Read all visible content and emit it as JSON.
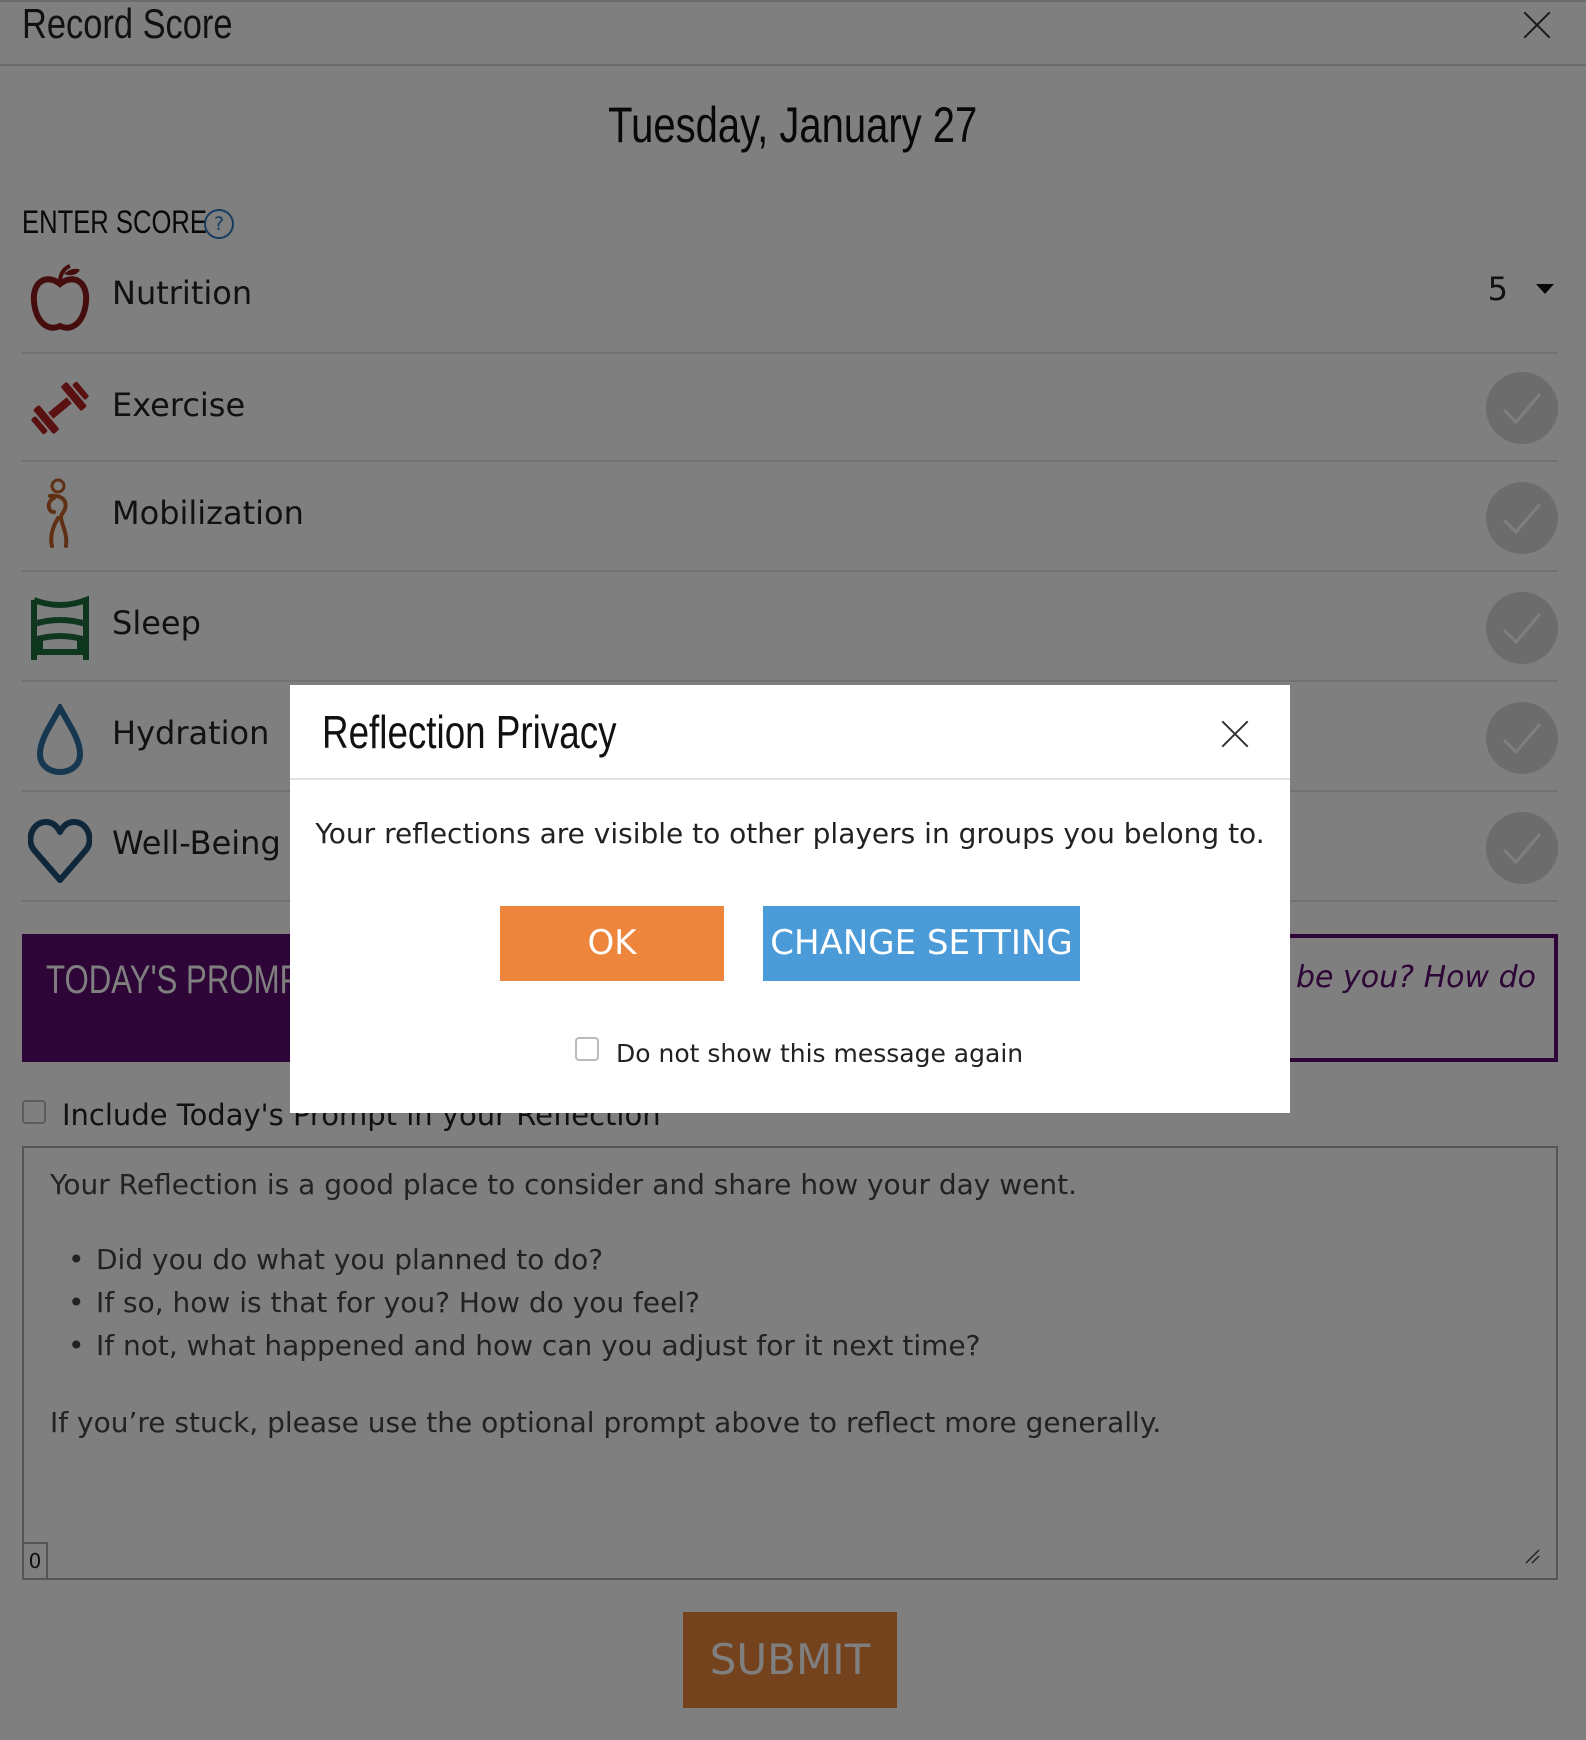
{
  "header": {
    "title": "Record Score"
  },
  "date": "Tuesday, January 27",
  "enter_score": {
    "label": "ENTER SCORE",
    "help_glyph": "?"
  },
  "categories": [
    {
      "label": "Nutrition",
      "icon": "apple-icon",
      "color": "#8a1a1a",
      "score": "5"
    },
    {
      "label": "Exercise",
      "icon": "dumbbell-icon",
      "color": "#b52323"
    },
    {
      "label": "Mobilization",
      "icon": "stretching-figure-icon",
      "color": "#c0612a"
    },
    {
      "label": "Sleep",
      "icon": "bed-icon",
      "color": "#1e6e3a"
    },
    {
      "label": "Hydration",
      "icon": "water-drop-icon",
      "color": "#2a6fa0"
    },
    {
      "label": "Well-Being",
      "icon": "heart-icon",
      "color": "#1c4e77"
    }
  ],
  "prompt": {
    "label": "TODAY'S PROMPT",
    "visible_text": "be you? How do",
    "color": "#5a0a6e"
  },
  "include_prompt": {
    "label": "Include Today's Prompt in your Reflection",
    "checked": false
  },
  "reflection": {
    "intro": "Your Reflection is a good place to consider and share how your day went.",
    "bullets": [
      "Did you do what you planned to do?",
      "If so, how is that for you? How do you feel?",
      "If not, what happened and how can you adjust for it next time?"
    ],
    "outro": "If you’re stuck, please use the optional prompt above to reflect more generally.",
    "char_count": "0"
  },
  "submit_label": "SUBMIT",
  "modal": {
    "title": "Reflection Privacy",
    "message": "Your reflections are visible to other players in groups you belong to.",
    "ok_label": "OK",
    "change_label": "CHANGE SETTING",
    "dont_show_label": "Do not show this message again",
    "dont_show_checked": false
  },
  "colors": {
    "ok": "#ee853c",
    "change": "#4a9bd8",
    "submit": "#e8843a"
  }
}
